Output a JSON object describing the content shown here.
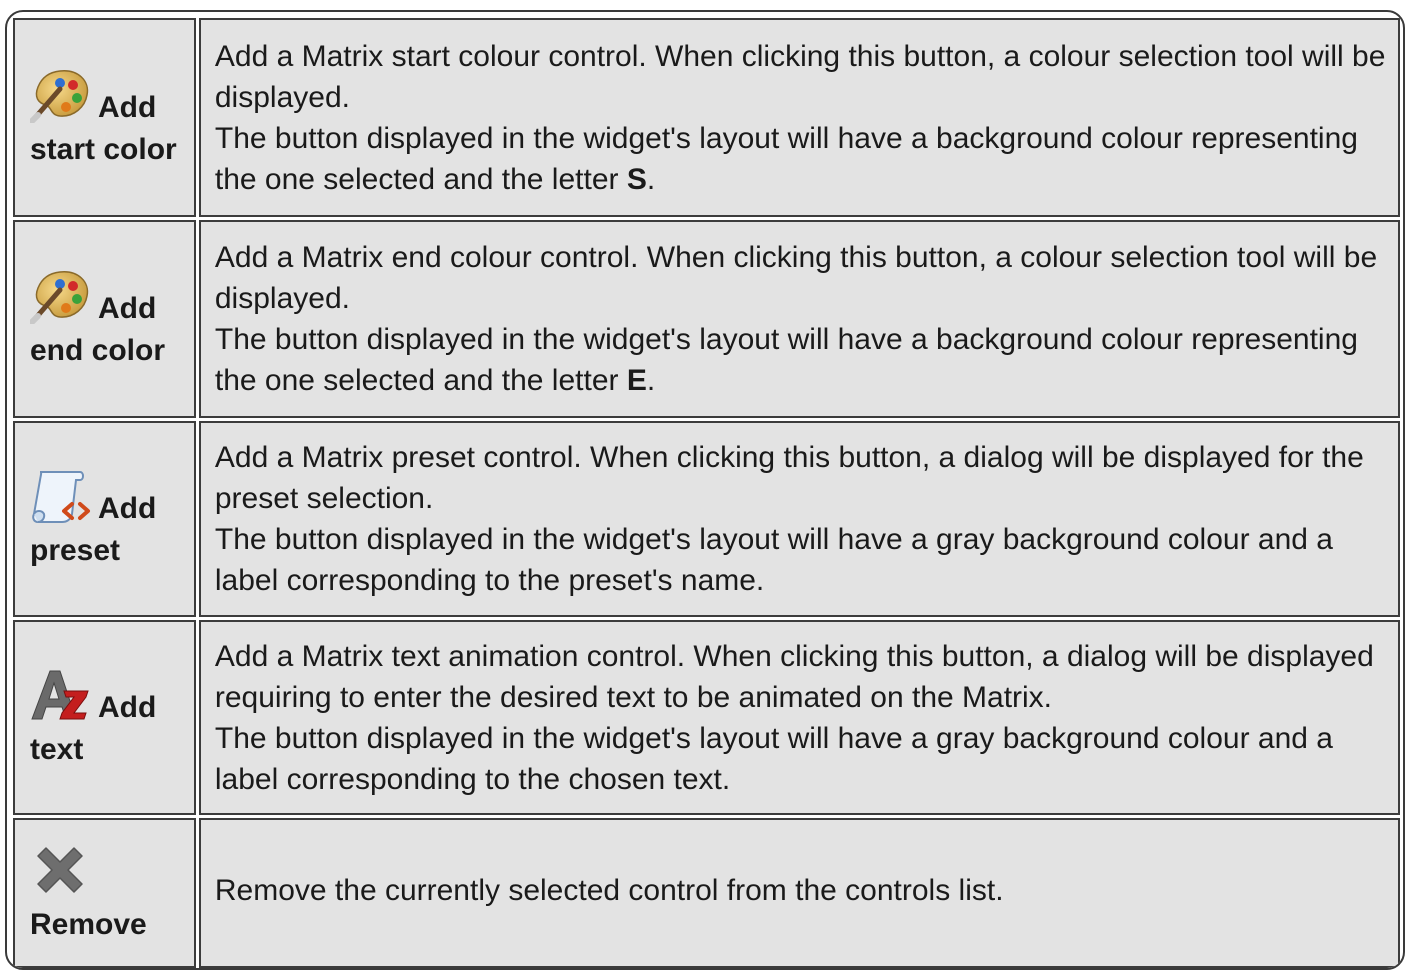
{
  "rows": [
    {
      "button_label_1": "Add",
      "button_label_2": "start color",
      "icon": "palette-icon",
      "desc_line_1": "Add a Matrix start colour control. When clicking this button, a colour selection tool will be displayed.",
      "desc_line_2": "The button displayed in the widget's layout will have a background colour representing the one selected and the letter ",
      "desc_bold": "S",
      "desc_end": "."
    },
    {
      "button_label_1": "Add",
      "button_label_2": "end color",
      "icon": "palette-icon",
      "desc_line_1": "Add a Matrix end colour control. When clicking this button, a colour selection tool will be displayed.",
      "desc_line_2": "The button displayed in the widget's layout will have a background colour representing the one selected and the letter ",
      "desc_bold": "E",
      "desc_end": "."
    },
    {
      "button_label_1": "Add",
      "button_label_2": "preset",
      "icon": "scroll-icon",
      "desc_line_1": "Add a Matrix preset control. When clicking this button, a dialog will be displayed for the preset selection.",
      "desc_line_2": "The button displayed in the widget's layout will have a gray background colour and a label corresponding to the preset's name."
    },
    {
      "button_label_1": "Add",
      "button_label_2": "text",
      "icon": "text-font-icon",
      "desc_line_1": "Add a Matrix text animation control. When clicking this button, a dialog will be displayed requiring to enter the desired text to be animated on the Matrix.",
      "desc_line_2": "The button displayed in the widget's layout will have a gray background colour and a label corresponding to the chosen text."
    },
    {
      "button_label_1": "Remove",
      "icon": "remove-x-icon",
      "desc_line_1": "Remove the currently selected control from the controls list."
    }
  ]
}
